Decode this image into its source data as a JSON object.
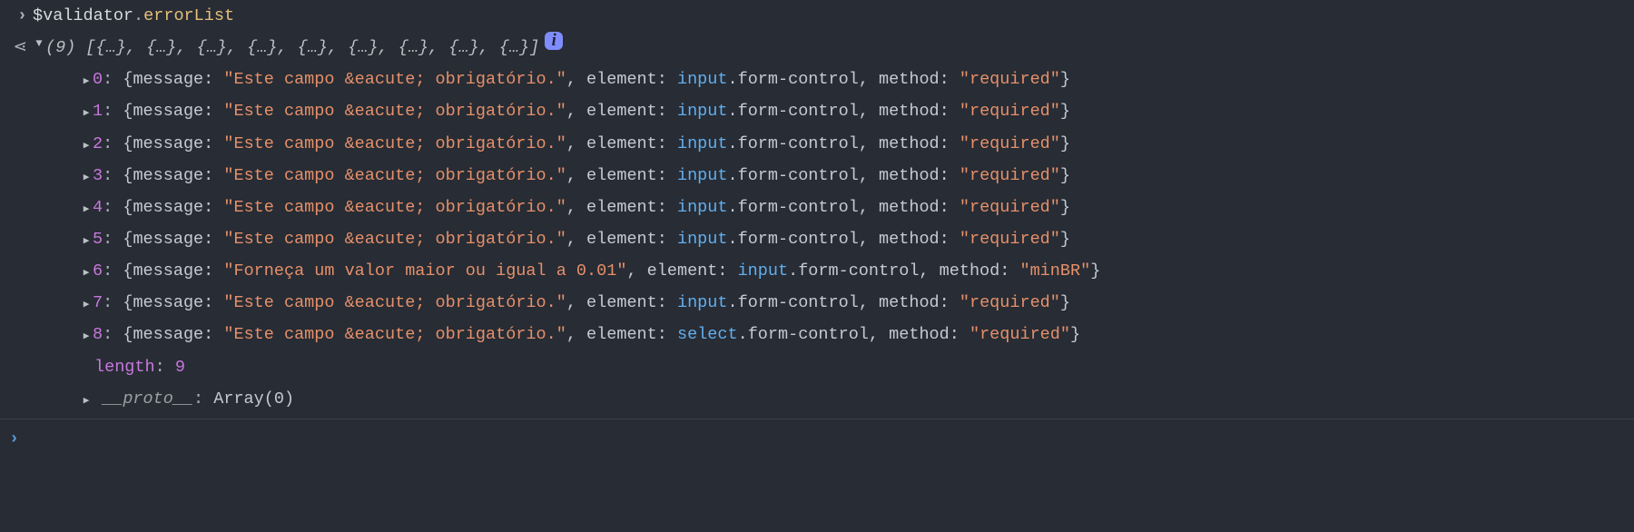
{
  "input_expr": {
    "var": "$validator",
    "dot": ".",
    "attr": "errorList"
  },
  "result_caret": "⋖",
  "summary": {
    "count_label": "(9)",
    "preview_open": " [",
    "preview_item": "{…}",
    "preview_sep": ", ",
    "preview_close": "]",
    "info_glyph": "i"
  },
  "items": [
    {
      "idx": "0",
      "message": "\"Este campo &eacute; obrigatório.\"",
      "el_cls": "input",
      "el_rest": ".form-control",
      "method": "\"required\""
    },
    {
      "idx": "1",
      "message": "\"Este campo &eacute; obrigatório.\"",
      "el_cls": "input",
      "el_rest": ".form-control",
      "method": "\"required\""
    },
    {
      "idx": "2",
      "message": "\"Este campo &eacute; obrigatório.\"",
      "el_cls": "input",
      "el_rest": ".form-control",
      "method": "\"required\""
    },
    {
      "idx": "3",
      "message": "\"Este campo &eacute; obrigatório.\"",
      "el_cls": "input",
      "el_rest": ".form-control",
      "method": "\"required\""
    },
    {
      "idx": "4",
      "message": "\"Este campo &eacute; obrigatório.\"",
      "el_cls": "input",
      "el_rest": ".form-control",
      "method": "\"required\""
    },
    {
      "idx": "5",
      "message": "\"Este campo &eacute; obrigatório.\"",
      "el_cls": "input",
      "el_rest": ".form-control",
      "method": "\"required\""
    },
    {
      "idx": "6",
      "message": "\"Forneça um valor maior ou igual a 0.01\"",
      "el_cls": "input",
      "el_rest": ".form-control",
      "method": "\"minBR\""
    },
    {
      "idx": "7",
      "message": "\"Este campo &eacute; obrigatório.\"",
      "el_cls": "input",
      "el_rest": ".form-control",
      "method": "\"required\""
    },
    {
      "idx": "8",
      "message": "\"Este campo &eacute; obrigatório.\"",
      "el_cls": "select",
      "el_rest": ".form-control",
      "method": "\"required\""
    }
  ],
  "labels": {
    "message_key": "message: ",
    "element_key": "element: ",
    "method_key": "method: ",
    "open_brace": " {",
    "close_brace": "}",
    "colon": ":",
    "comma": ", "
  },
  "length_row": {
    "key": "length",
    "value": "9"
  },
  "proto_row": {
    "key": "__proto__",
    "value": "Array(0)"
  },
  "triangles": {
    "right": "▶",
    "down": "▼"
  },
  "input_caret": "›",
  "new_prompt_caret": "›"
}
